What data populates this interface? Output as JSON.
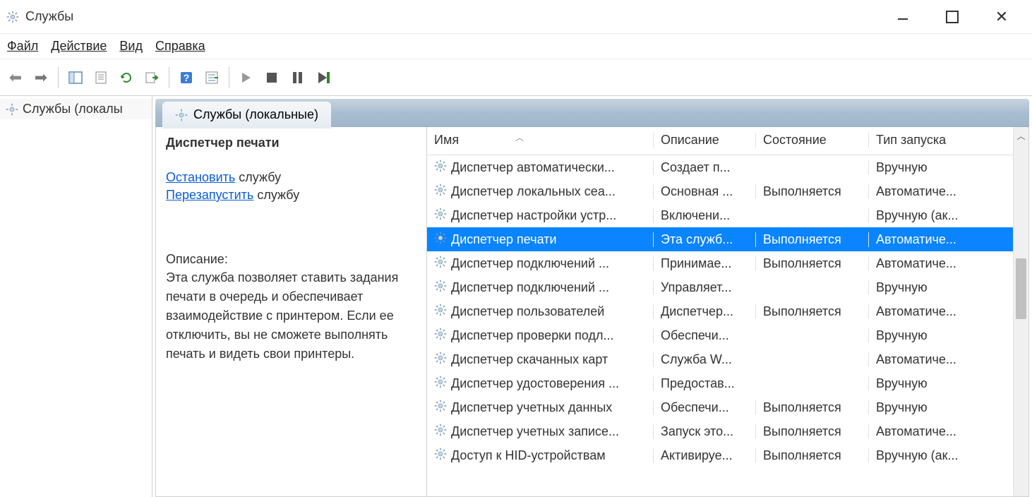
{
  "window": {
    "title": "Службы"
  },
  "menus": {
    "file": "Файл",
    "action": "Действие",
    "view": "Вид",
    "help": "Справка"
  },
  "tree": {
    "root": "Службы (локалы"
  },
  "tab": {
    "label": "Службы (локальные)"
  },
  "detail": {
    "title": "Диспетчер печати",
    "stop_link": "Остановить",
    "restart_link": "Перезапустить",
    "service_word": "службу",
    "desc_label": "Описание:",
    "desc_text": "Эта служба позволяет ставить задания печати в очередь и обеспечивает взаимодействие с принтером. Если ее отключить, вы не сможете выполнять печать и видеть свои принтеры."
  },
  "columns": {
    "name": "Имя",
    "desc": "Описание",
    "state": "Состояние",
    "start": "Тип запуска"
  },
  "rows": [
    {
      "name": "Диспетчер автоматически...",
      "desc": "Создает п...",
      "state": "",
      "start": "Вручную"
    },
    {
      "name": "Диспетчер локальных сеа...",
      "desc": "Основная ...",
      "state": "Выполняется",
      "start": "Автоматиче..."
    },
    {
      "name": "Диспетчер настройки устр...",
      "desc": "Включени...",
      "state": "",
      "start": "Вручную (ак..."
    },
    {
      "name": "Диспетчер печати",
      "desc": "Эта служб...",
      "state": "Выполняется",
      "start": "Автоматиче...",
      "selected": true
    },
    {
      "name": "Диспетчер подключений ...",
      "desc": "Принимае...",
      "state": "Выполняется",
      "start": "Автоматиче..."
    },
    {
      "name": "Диспетчер подключений ...",
      "desc": "Управляет...",
      "state": "",
      "start": "Вручную"
    },
    {
      "name": "Диспетчер пользователей",
      "desc": "Диспетчер...",
      "state": "Выполняется",
      "start": "Автоматиче..."
    },
    {
      "name": "Диспетчер проверки подл...",
      "desc": "Обеспечи...",
      "state": "",
      "start": "Вручную"
    },
    {
      "name": "Диспетчер скачанных карт",
      "desc": "Служба W...",
      "state": "",
      "start": "Автоматиче..."
    },
    {
      "name": "Диспетчер удостоверения ...",
      "desc": "Предостав...",
      "state": "",
      "start": "Вручную"
    },
    {
      "name": "Диспетчер учетных данных",
      "desc": "Обеспечи...",
      "state": "Выполняется",
      "start": "Вручную"
    },
    {
      "name": "Диспетчер учетных записе...",
      "desc": "Запуск это...",
      "state": "Выполняется",
      "start": "Автоматиче..."
    },
    {
      "name": "Доступ к HID-устройствам",
      "desc": "Активируе...",
      "state": "Выполняется",
      "start": "Вручную (ак..."
    }
  ]
}
